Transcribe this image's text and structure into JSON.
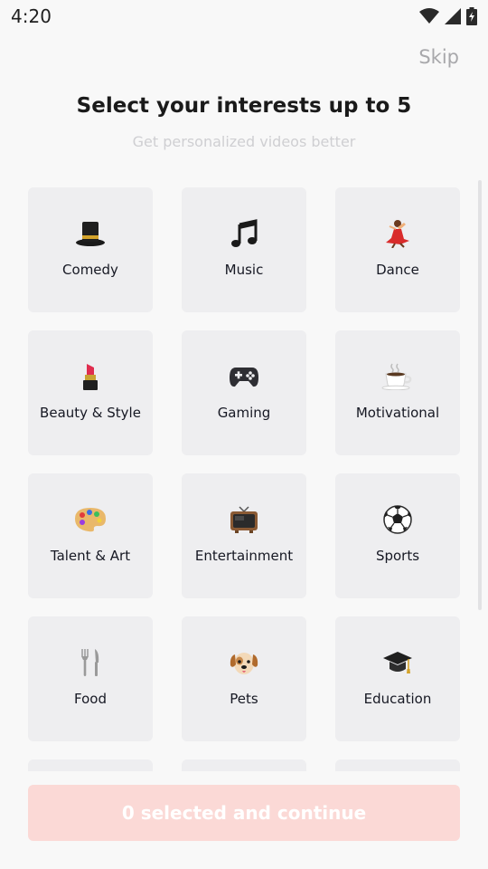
{
  "status_bar": {
    "time": "4:20",
    "icons": [
      "wifi-icon",
      "signal-icon",
      "battery-icon"
    ]
  },
  "header": {
    "skip_label": "Skip",
    "title": "Select your interests up to 5",
    "subtitle": "Get personalized videos better"
  },
  "interests": [
    {
      "label": "Comedy",
      "icon": "top-hat-icon"
    },
    {
      "label": "Music",
      "icon": "music-notes-icon"
    },
    {
      "label": "Dance",
      "icon": "dancer-icon"
    },
    {
      "label": "Beauty & Style",
      "icon": "lipstick-icon"
    },
    {
      "label": "Gaming",
      "icon": "gamepad-icon"
    },
    {
      "label": "Motivational",
      "icon": "coffee-icon"
    },
    {
      "label": "Talent & Art",
      "icon": "palette-icon"
    },
    {
      "label": "Entertainment",
      "icon": "television-icon"
    },
    {
      "label": "Sports",
      "icon": "soccer-ball-icon"
    },
    {
      "label": "Food",
      "icon": "fork-knife-icon"
    },
    {
      "label": "Pets",
      "icon": "dog-icon"
    },
    {
      "label": "Education",
      "icon": "graduation-cap-icon"
    }
  ],
  "footer": {
    "continue_label": "0 selected and continue"
  },
  "colors": {
    "tile_background": "#eeeef0",
    "continue_button_disabled": "#fbd9d6",
    "background": "#f8f8f8"
  }
}
